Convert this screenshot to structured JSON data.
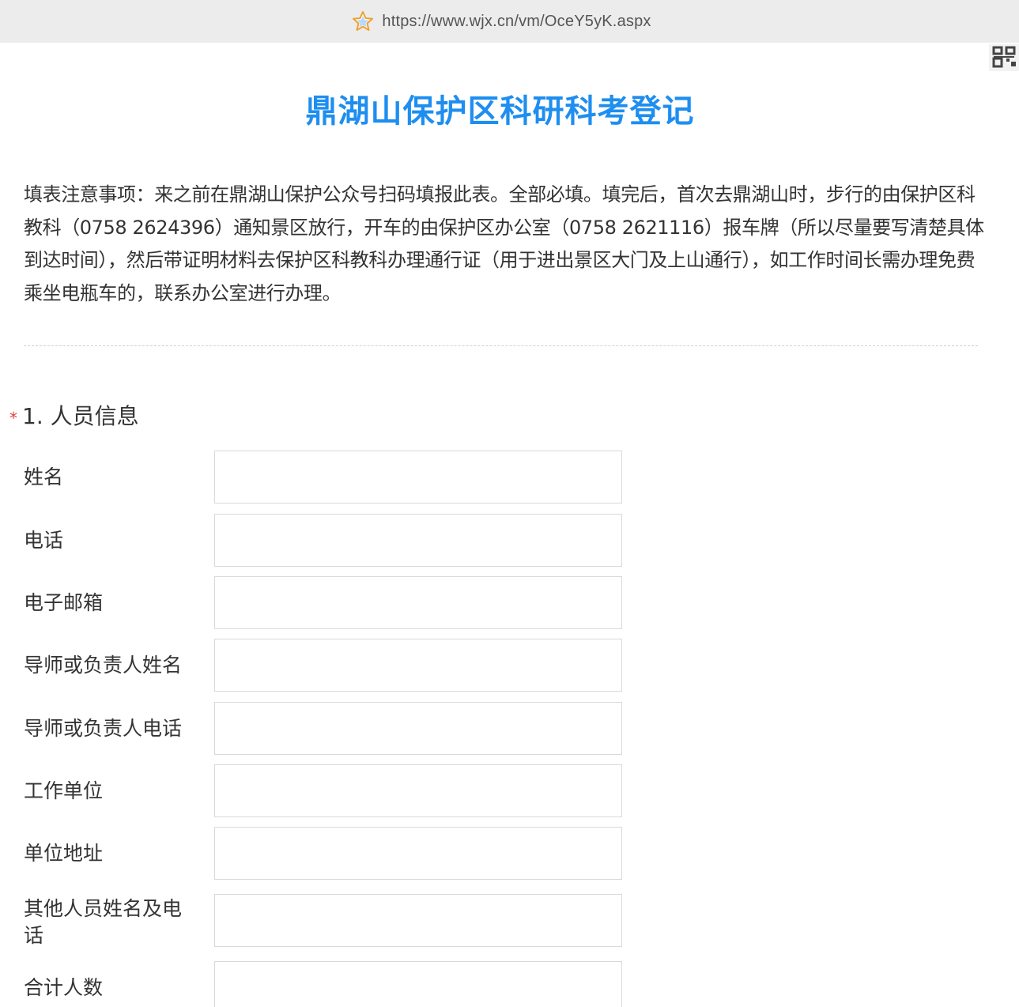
{
  "browser": {
    "url": "https://www.wjx.cn/vm/OceY5yK.aspx",
    "icons": [
      "star-icon",
      "qr-code-icon"
    ]
  },
  "survey": {
    "title": "鼎湖山保护区科研科考登记",
    "notice": "填表注意事项：来之前在鼎湖山保护公众号扫码填报此表。全部必填。填完后，首次去鼎湖山时，步行的由保护区科教科（0758 2624396）通知景区放行，开车的由保护区办公室（0758 2621116）报车牌（所以尽量要写清楚具体到达时间），然后带证明材料去保护区科教科办理通行证（用于进出景区大门及上山通行），如工作时间长需办理免费乘坐电瓶车的，联系办公室进行办理。"
  },
  "question1": {
    "required_mark": "*",
    "title": "1. 人员信息",
    "fields": [
      {
        "label": "姓名",
        "value": ""
      },
      {
        "label": "电话",
        "value": ""
      },
      {
        "label": "电子邮箱",
        "value": ""
      },
      {
        "label": "导师或负责人姓名",
        "value": ""
      },
      {
        "label": "导师或负责人电话",
        "value": ""
      },
      {
        "label": "工作单位",
        "value": ""
      },
      {
        "label": "单位地址",
        "value": ""
      },
      {
        "label": "其他人员姓名及电话",
        "value": ""
      },
      {
        "label": "合计人数",
        "value": ""
      }
    ]
  },
  "colors": {
    "title_blue": "#1e8ef0",
    "required_red": "#e93b3b",
    "url_bar_bg": "#ececec"
  }
}
